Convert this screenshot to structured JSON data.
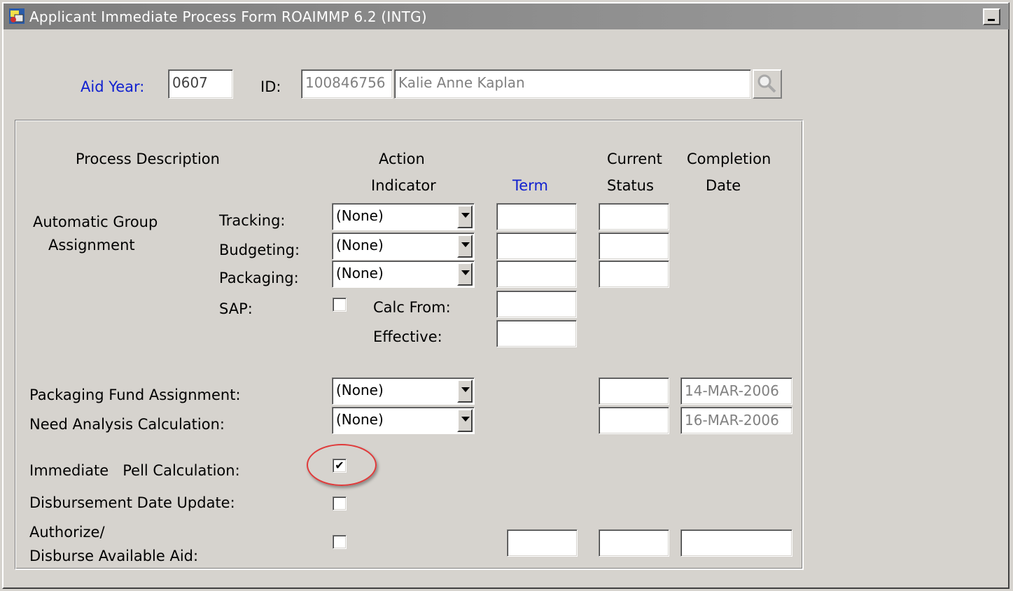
{
  "window": {
    "title": "Applicant Immediate Process Form  ROAIMMP  6.2  (INTG)",
    "icons": {
      "app": "oracle-forms-icon",
      "minimize": "minimize-icon",
      "search": "magnifier-icon"
    }
  },
  "header": {
    "aid_year_label": "Aid Year:",
    "aid_year_value": "0607",
    "id_label": "ID:",
    "id_value": "100846756",
    "name_value": "Kalie Anne Kaplan"
  },
  "columns": {
    "process_description": "Process Description",
    "action_line1": "Action",
    "action_line2": "Indicator",
    "term": "Term",
    "current_line1": "Current",
    "current_line2": "Status",
    "completion_line1": "Completion",
    "completion_line2": "Date"
  },
  "group_assignment": {
    "label_line1": "Automatic Group",
    "label_line2": "Assignment",
    "tracking_label": "Tracking:",
    "tracking_value": "(None)",
    "budgeting_label": "Budgeting:",
    "budgeting_value": "(None)",
    "packaging_label": "Packaging:",
    "packaging_value": "(None)",
    "sap_label": "SAP:",
    "calc_from_label": "Calc From:",
    "effective_label": "Effective:"
  },
  "fund_assignment": {
    "label": "Packaging Fund Assignment:",
    "value": "(None)",
    "completion_date": "14-MAR-2006"
  },
  "need_analysis": {
    "label": "Need Analysis Calculation:",
    "value": "(None)",
    "completion_date": "16-MAR-2006"
  },
  "pell": {
    "label": "Immediate   Pell Calculation:",
    "checked": true,
    "check_glyph": "✔",
    "highlight_color": "#e03a3a"
  },
  "disbursement_update": {
    "label": "Disbursement Date Update:",
    "checked": false
  },
  "authorize": {
    "label_line1": "Authorize/",
    "label_line2": "Disburse Available Aid:",
    "checked": false
  },
  "colors": {
    "background": "#d6d3ce",
    "label_blue": "#1020d0",
    "title_bar": "#8a8a8a"
  }
}
